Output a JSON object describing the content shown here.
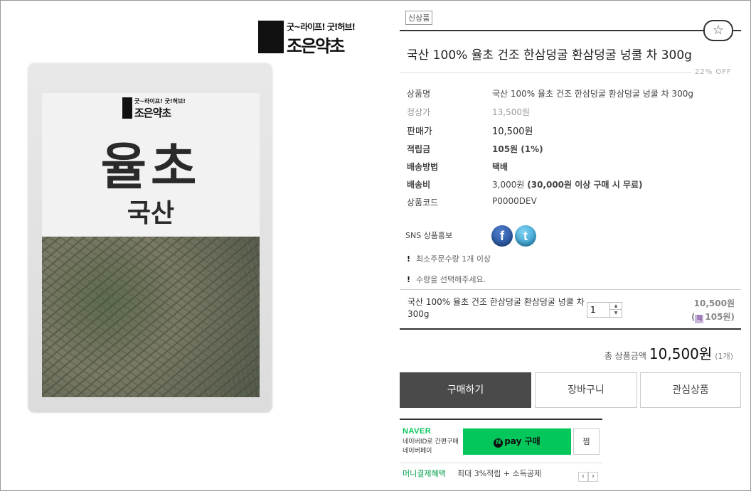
{
  "brand": {
    "tagline": "굿~라이프! 굿!허브!",
    "name": "조은약초"
  },
  "package": {
    "mini_tagline": "굿~라이프! 굿!허브!",
    "mini_name": "조은약초",
    "big_text": "율초",
    "origin_text": "국산"
  },
  "badge_new": "신상품",
  "product_title": "국산 100% 율초 건조 한삼덩굴 환삼덩굴 넝쿨 차 300g",
  "discount": "22% OFF",
  "info": {
    "name_label": "상품명",
    "name_value": "국산 100% 율초 건조 한삼덩굴 환삼덩굴 넝쿨 차 300g",
    "list_price_label": "정상가",
    "list_price_value": "13,500원",
    "sale_price_label": "판매가",
    "sale_price_value": "10,500원",
    "points_label": "적립금",
    "points_value": "105원 (1%)",
    "shipping_method_label": "배송방법",
    "shipping_method_value": "택배",
    "shipping_fee_label": "배송비",
    "shipping_fee_value": "3,000원",
    "shipping_fee_note": "(30,000원 이상 구매 시 무료)",
    "code_label": "상품코드",
    "code_value": "P0000DEV"
  },
  "sns": {
    "label": "SNS 상품홍보",
    "facebook_glyph": "f",
    "twitter_glyph": "t"
  },
  "notices": {
    "min_order": "최소주문수량 1개 이상",
    "select_qty": "수량을 선택해주세요."
  },
  "option": {
    "name": "국산 100% 율초 건조 한삼덩굴 환삼덩굴 넝쿨 차 300g",
    "quantity": "1",
    "price": "10,500원",
    "point": "105원)"
  },
  "total": {
    "label": "총 상품금액",
    "amount": "10,500원",
    "count": "(1개)"
  },
  "buttons": {
    "buy": "구매하기",
    "cart": "장바구니",
    "wish": "관심상품"
  },
  "npay": {
    "naver": "NAVER",
    "desc_line1": "네이버ID로 간편구매",
    "desc_line2": "네이버페이",
    "pay_label": "pay 구매",
    "zzim": "찜",
    "money_label": "머니결제혜택",
    "money_sub": "최대 3%적립 + 소득공제"
  },
  "colors": {
    "naver_green": "#03c75a",
    "buy_button": "#4a4a4a"
  }
}
